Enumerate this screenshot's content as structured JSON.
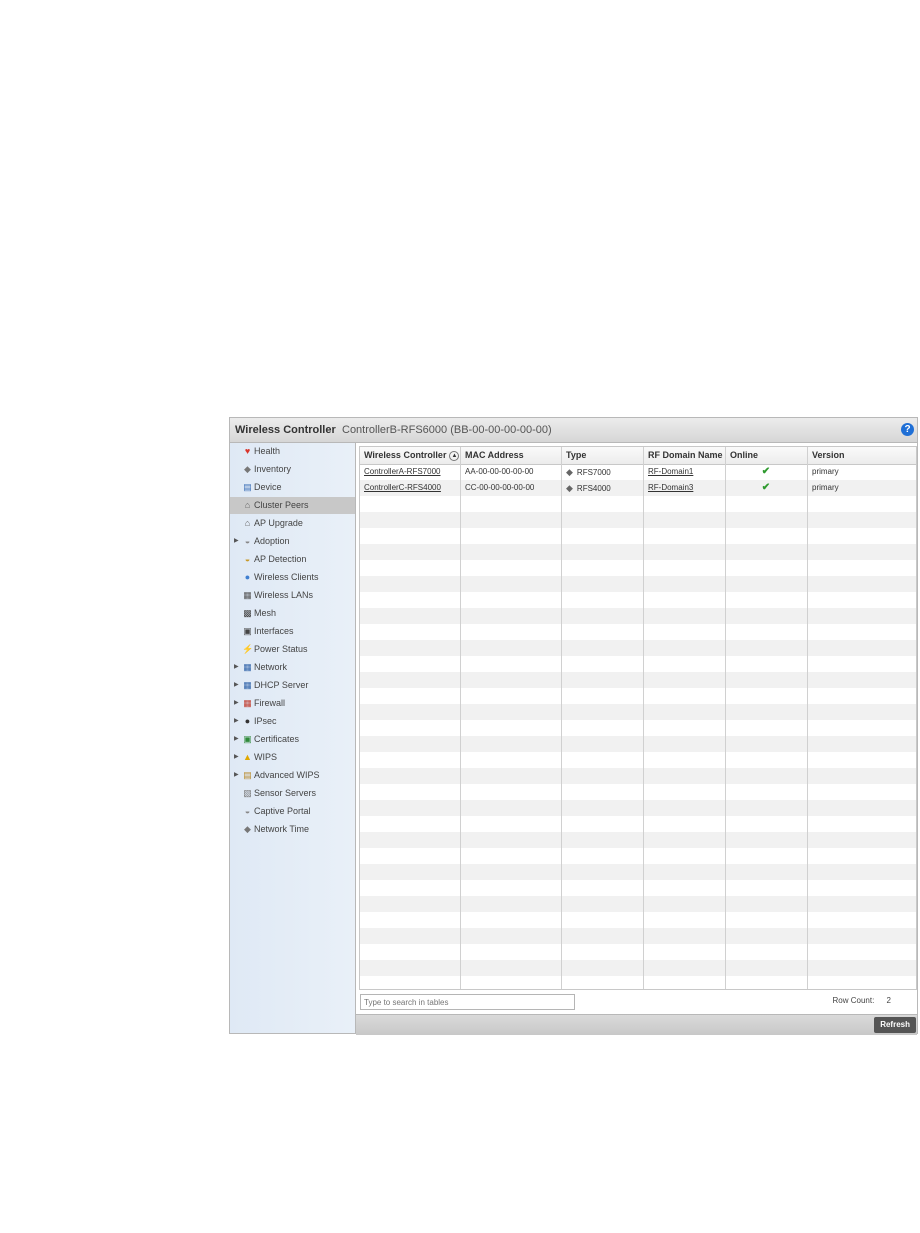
{
  "title": {
    "section": "Wireless Controller",
    "context": "ControllerB-RFS6000 (BB-00-00-00-00-00)",
    "help_symbol": "?"
  },
  "sidebar": {
    "items": [
      {
        "label": "Health",
        "icon": "health-icon",
        "glyph": "♥",
        "color": "#d9352b",
        "expandable": false,
        "active": false
      },
      {
        "label": "Inventory",
        "icon": "inventory-icon",
        "glyph": "◆",
        "color": "#777777",
        "expandable": false,
        "active": false
      },
      {
        "label": "Device",
        "icon": "device-icon",
        "glyph": "▤",
        "color": "#3b6fb6",
        "expandable": false,
        "active": false
      },
      {
        "label": "Cluster Peers",
        "icon": "cluster-peers-icon",
        "glyph": "⌂",
        "color": "#666666",
        "expandable": false,
        "active": true
      },
      {
        "label": "AP Upgrade",
        "icon": "ap-upgrade-icon",
        "glyph": "⌂",
        "color": "#666666",
        "expandable": false,
        "active": false
      },
      {
        "label": "Adoption",
        "icon": "adoption-icon",
        "glyph": "◒",
        "color": "#888888",
        "expandable": true,
        "active": false
      },
      {
        "label": "AP Detection",
        "icon": "ap-detection-icon",
        "glyph": "◒",
        "color": "#c89a2a",
        "expandable": false,
        "active": false
      },
      {
        "label": "Wireless Clients",
        "icon": "wireless-clients-icon",
        "glyph": "●",
        "color": "#3f7fd0",
        "expandable": false,
        "active": false
      },
      {
        "label": "Wireless LANs",
        "icon": "wireless-lans-icon",
        "glyph": "▦",
        "color": "#555555",
        "expandable": false,
        "active": false
      },
      {
        "label": "Mesh",
        "icon": "mesh-icon",
        "glyph": "▩",
        "color": "#444444",
        "expandable": false,
        "active": false
      },
      {
        "label": "Interfaces",
        "icon": "interfaces-icon",
        "glyph": "▣",
        "color": "#444444",
        "expandable": false,
        "active": false
      },
      {
        "label": "Power Status",
        "icon": "power-status-icon",
        "glyph": "⚡",
        "color": "#555555",
        "expandable": false,
        "active": false
      },
      {
        "label": "Network",
        "icon": "network-icon",
        "glyph": "▦",
        "color": "#2e62a8",
        "expandable": true,
        "active": false
      },
      {
        "label": "DHCP Server",
        "icon": "dhcp-server-icon",
        "glyph": "▦",
        "color": "#2e62a8",
        "expandable": true,
        "active": false
      },
      {
        "label": "Firewall",
        "icon": "firewall-icon",
        "glyph": "▦",
        "color": "#c0392b",
        "expandable": true,
        "active": false
      },
      {
        "label": "IPsec",
        "icon": "ipsec-icon",
        "glyph": "●",
        "color": "#333333",
        "expandable": true,
        "active": false
      },
      {
        "label": "Certificates",
        "icon": "certificates-icon",
        "glyph": "▣",
        "color": "#2f8a3a",
        "expandable": true,
        "active": false
      },
      {
        "label": "WIPS",
        "icon": "wips-icon",
        "glyph": "▲",
        "color": "#e0a800",
        "expandable": true,
        "active": false
      },
      {
        "label": "Advanced WIPS",
        "icon": "advanced-wips-icon",
        "glyph": "▤",
        "color": "#b88a2a",
        "expandable": true,
        "active": false
      },
      {
        "label": "Sensor Servers",
        "icon": "sensor-servers-icon",
        "glyph": "▧",
        "color": "#777777",
        "expandable": false,
        "active": false
      },
      {
        "label": "Captive Portal",
        "icon": "captive-portal-icon",
        "glyph": "◒",
        "color": "#888888",
        "expandable": false,
        "active": false
      },
      {
        "label": "Network Time",
        "icon": "network-time-icon",
        "glyph": "◆",
        "color": "#777777",
        "expandable": false,
        "active": false
      }
    ]
  },
  "table": {
    "columns": [
      {
        "label": "Wireless Controller",
        "sortable": true
      },
      {
        "label": "MAC Address",
        "sortable": false
      },
      {
        "label": "Type",
        "sortable": false
      },
      {
        "label": "RF Domain Name",
        "sortable": false
      },
      {
        "label": "Online",
        "sortable": false
      },
      {
        "label": "Version",
        "sortable": false
      }
    ],
    "rows": [
      {
        "controller": "ControllerA-RFS7000",
        "mac": "AA-00-00-00-00-00",
        "type": "RFS7000",
        "rf_domain": "RF-Domain1",
        "online": "✔",
        "version": "primary"
      },
      {
        "controller": "ControllerC-RFS4000",
        "mac": "CC-00-00-00-00-00",
        "type": "RFS4000",
        "rf_domain": "RF-Domain3",
        "online": "✔",
        "version": "primary"
      }
    ],
    "empty_rows": 31
  },
  "search": {
    "placeholder": "Type to search in tables"
  },
  "row_count": {
    "label": "Row Count:",
    "value": "2"
  },
  "buttons": {
    "refresh": "Refresh"
  },
  "colors": {
    "help": "#1f6fd6",
    "online_check": "#2f9a2f",
    "active_nav": "#c8c8c8"
  }
}
